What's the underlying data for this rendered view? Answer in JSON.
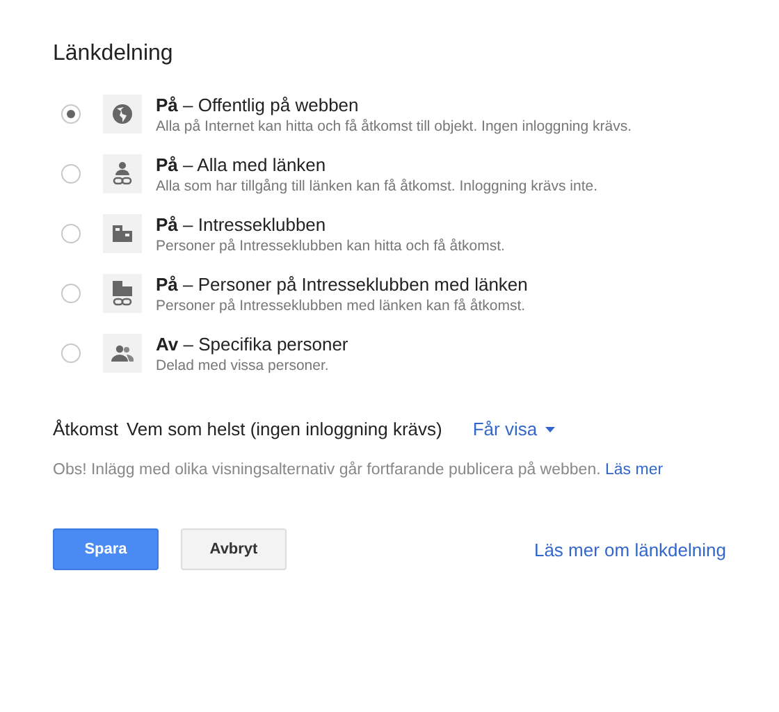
{
  "title": "Länkdelning",
  "options": [
    {
      "kind": "globe",
      "title": "**På** – Offentlig på webben",
      "description": "Alla på Internet kan hitta och få åtkomst till objekt. Ingen inloggning krävs.",
      "selected": true
    },
    {
      "kind": "person-link",
      "title": "**På** – Alla med länken",
      "description": "Alla som har tillgång till länken kan få åtkomst. Inloggning krävs inte.",
      "selected": false
    },
    {
      "kind": "building",
      "title": "**På** – Intresseklubben",
      "description": "Personer på Intresseklubben kan hitta och få åtkomst.",
      "selected": false
    },
    {
      "kind": "building-link",
      "title": "**På** – Personer på Intresseklubben med länken",
      "description": "Personer på Intresseklubben med länken kan få åtkomst.",
      "selected": false
    },
    {
      "kind": "people",
      "title": "**Av** – Specifika personer",
      "description": "Delad med vissa personer.",
      "selected": false
    }
  ],
  "access": {
    "label": "Åtkomst",
    "value": "Vem som helst (ingen inloggning krävs)",
    "dropdown": "Får visa"
  },
  "note": {
    "text": "Obs! Inlägg med olika visningsalternativ går fortfarande publicera på webben.",
    "link": "Läs mer"
  },
  "buttons": {
    "save": "Spara",
    "cancel": "Avbryt",
    "help_link": "Läs mer om länkdelning"
  }
}
